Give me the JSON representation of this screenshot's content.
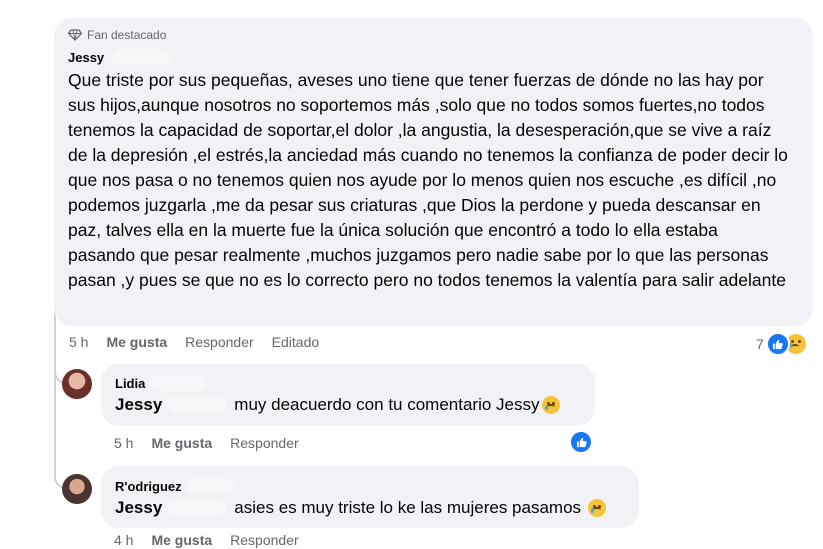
{
  "main_comment": {
    "badge_label": "Fan destacado",
    "author": "Jessy",
    "text": "Que triste por sus pequeñas, aveses uno tiene que tener fuerzas de dónde no las hay por sus hijos,aunque nosotros no soportemos más ,solo que no todos somos fuertes,no todos tenemos la capacidad de soportar,el dolor ,la angustia, la desesperación,que se vive a raíz de la depresión ,el estrés,la anciedad más cuando no tenemos la confianza de poder decir lo que nos pasa o no tenemos quien nos ayude por lo menos quien nos escuche ,es difícil ,no podemos juzgarla ,me da pesar sus criaturas ,que Dios la perdone y pueda descansar en paz, talves ella en la muerte fue la única solución que encontró a todo lo ella estaba pasando que pesar realmente ,muchos juzgamos pero nadie sabe por lo que las personas pasan ,y pues se que no es lo correcto pero no todos tenemos la valentía para salir adelante",
    "time": "5 h",
    "like_label": "Me gusta",
    "reply_label": "Responder",
    "edited_label": "Editado",
    "reaction_count": "7"
  },
  "replies": [
    {
      "author": "Lidia",
      "mention": "Jessy",
      "text": "muy deacuerdo con tu comentario Jessy",
      "time": "5 h",
      "like_label": "Me gusta",
      "reply_label": "Responder"
    },
    {
      "author": "R'odriguez",
      "mention": "Jessy",
      "text": "asies es muy triste lo ke las mujeres pasamos",
      "time": "4 h",
      "like_label": "Me gusta",
      "reply_label": "Responder"
    }
  ],
  "colors": {
    "bubble": "#f0f2f5",
    "secondary_text": "#65676b",
    "like_blue": "#1877f2"
  }
}
